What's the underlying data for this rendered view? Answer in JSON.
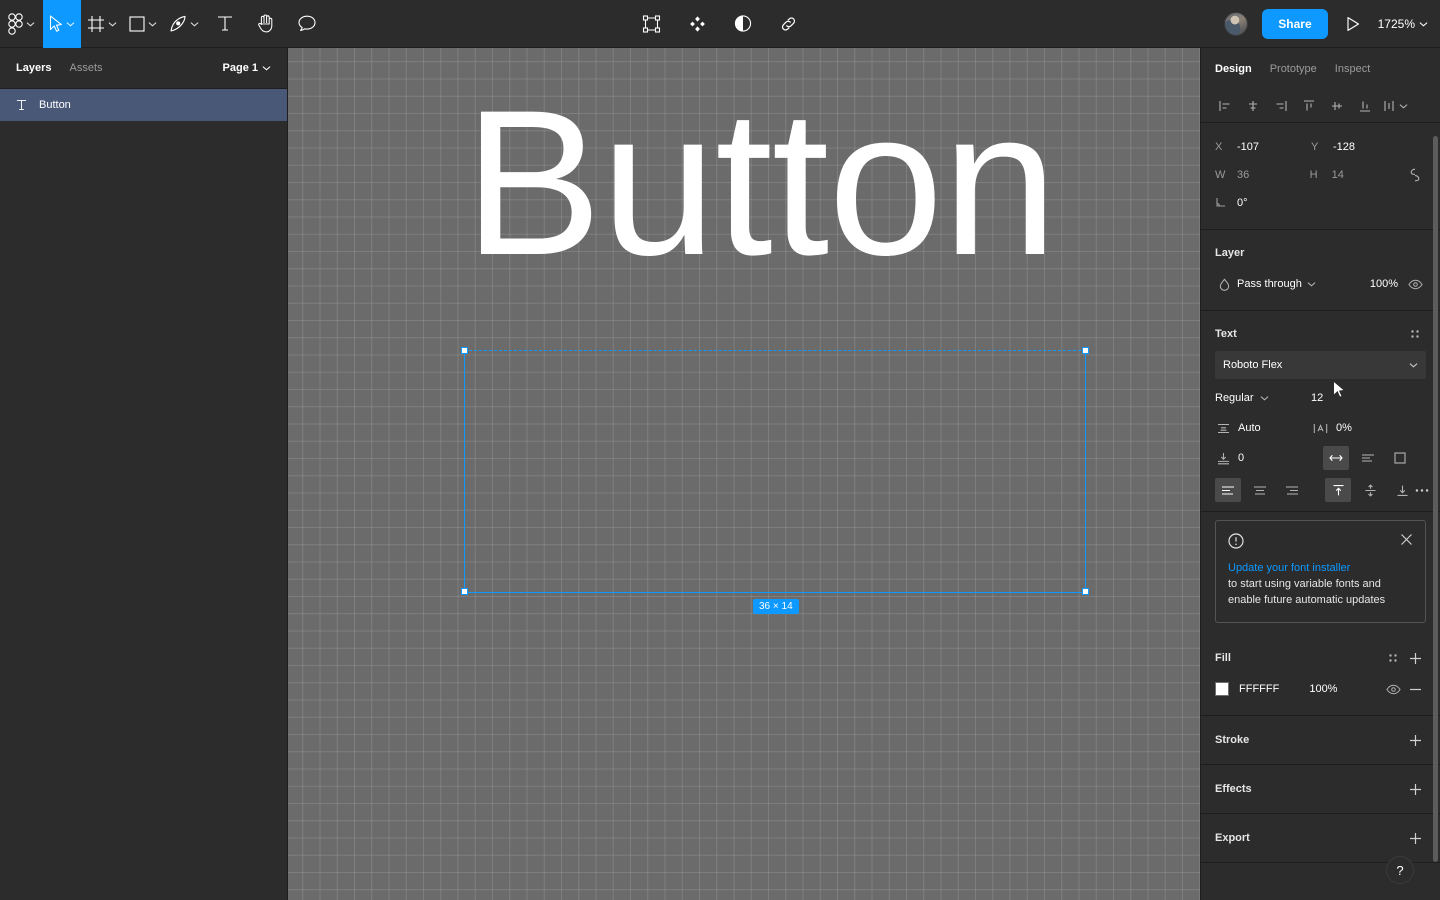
{
  "toolbar": {
    "left_tools": [
      {
        "name": "figma-menu-icon",
        "label": "Main menu",
        "has_chevron": true,
        "active": false
      },
      {
        "name": "move-tool-icon",
        "label": "Move",
        "has_chevron": true,
        "active": true
      },
      {
        "name": "frame-tool-icon",
        "label": "Frame",
        "has_chevron": true,
        "active": false
      },
      {
        "name": "shape-tool-icon",
        "label": "Rectangle",
        "has_chevron": true,
        "active": false
      },
      {
        "name": "pen-tool-icon",
        "label": "Pen",
        "has_chevron": true,
        "active": false
      },
      {
        "name": "text-tool-icon",
        "label": "Text",
        "has_chevron": false,
        "active": false
      },
      {
        "name": "hand-tool-icon",
        "label": "Hand",
        "has_chevron": false,
        "active": false
      },
      {
        "name": "comment-tool-icon",
        "label": "Comment",
        "has_chevron": false,
        "active": false
      }
    ],
    "center_tools": [
      {
        "name": "create-component-icon",
        "label": "Create component"
      },
      {
        "name": "component-instance-icon",
        "label": "Component"
      },
      {
        "name": "mask-icon",
        "label": "Use as mask"
      },
      {
        "name": "link-icon",
        "label": "Link"
      }
    ],
    "avatar": "user-avatar",
    "share_label": "Share",
    "present_icon": "play-icon",
    "zoom_level": "1725%"
  },
  "left_panel": {
    "tabs": [
      {
        "label": "Layers",
        "active": true
      },
      {
        "label": "Assets",
        "active": false
      }
    ],
    "page": "Page 1",
    "layers": [
      {
        "icon": "text-layer-icon",
        "name": "Button",
        "selected": true
      }
    ]
  },
  "canvas": {
    "text_content": "Button",
    "size_badge": "36 × 14",
    "selection_color": "#0d99ff",
    "background_color": "#6b6b6b"
  },
  "right_panel": {
    "tabs": [
      {
        "label": "Design",
        "active": true
      },
      {
        "label": "Prototype",
        "active": false
      },
      {
        "label": "Inspect",
        "active": false
      }
    ],
    "align_buttons": [
      {
        "name": "align-left-icon",
        "label": "Align left"
      },
      {
        "name": "align-horizontal-centers-icon",
        "label": "Align horizontal centers"
      },
      {
        "name": "align-right-icon",
        "label": "Align right"
      },
      {
        "name": "align-top-icon",
        "label": "Align top"
      },
      {
        "name": "align-vertical-centers-icon",
        "label": "Align vertical centers"
      },
      {
        "name": "align-bottom-icon",
        "label": "Align bottom"
      },
      {
        "name": "distribute-icon",
        "label": "Distribute"
      }
    ],
    "transform": {
      "x_label": "X",
      "x_value": "-107",
      "y_label": "Y",
      "y_value": "-128",
      "w_label": "W",
      "w_value": "36",
      "h_label": "H",
      "h_value": "14",
      "rotation_value": "0°",
      "constrain_icon": "constrain-proportions-icon"
    },
    "layer": {
      "title": "Layer",
      "blend_mode": "Pass through",
      "opacity": "100%",
      "visibility_icon": "eye-icon"
    },
    "text": {
      "title": "Text",
      "settings_icon": "text-settings-icon",
      "font_family": "Roboto Flex",
      "font_weight": "Regular",
      "font_size": "12",
      "line_height": "Auto",
      "letter_spacing": "0%",
      "paragraph_spacing": "0",
      "resize_icons": [
        "auto-width-icon",
        "auto-height-icon",
        "fixed-size-icon"
      ],
      "align_icons": [
        "text-align-left-icon",
        "text-align-center-icon",
        "text-align-right-icon"
      ],
      "valign_icons": [
        "text-align-top-icon",
        "text-align-middle-icon",
        "text-align-bottom-icon"
      ],
      "more_icon": "more-options-icon"
    },
    "notice": {
      "icon": "alert-circle-icon",
      "close_icon": "close-icon",
      "link_text": "Update your font installer",
      "body_line1": "to start using variable fonts and",
      "body_line2": "enable future automatic updates"
    },
    "fill": {
      "title": "Fill",
      "settings_icon": "fill-settings-icon",
      "add_icon": "plus-icon",
      "color_hex": "FFFFFF",
      "opacity": "100%",
      "visibility_icon": "eye-icon",
      "remove_icon": "minus-icon"
    },
    "stroke": {
      "title": "Stroke",
      "add_icon": "plus-icon"
    },
    "effects": {
      "title": "Effects",
      "add_icon": "plus-icon"
    },
    "export": {
      "title": "Export",
      "add_icon": "plus-icon"
    },
    "help_label": "?"
  }
}
